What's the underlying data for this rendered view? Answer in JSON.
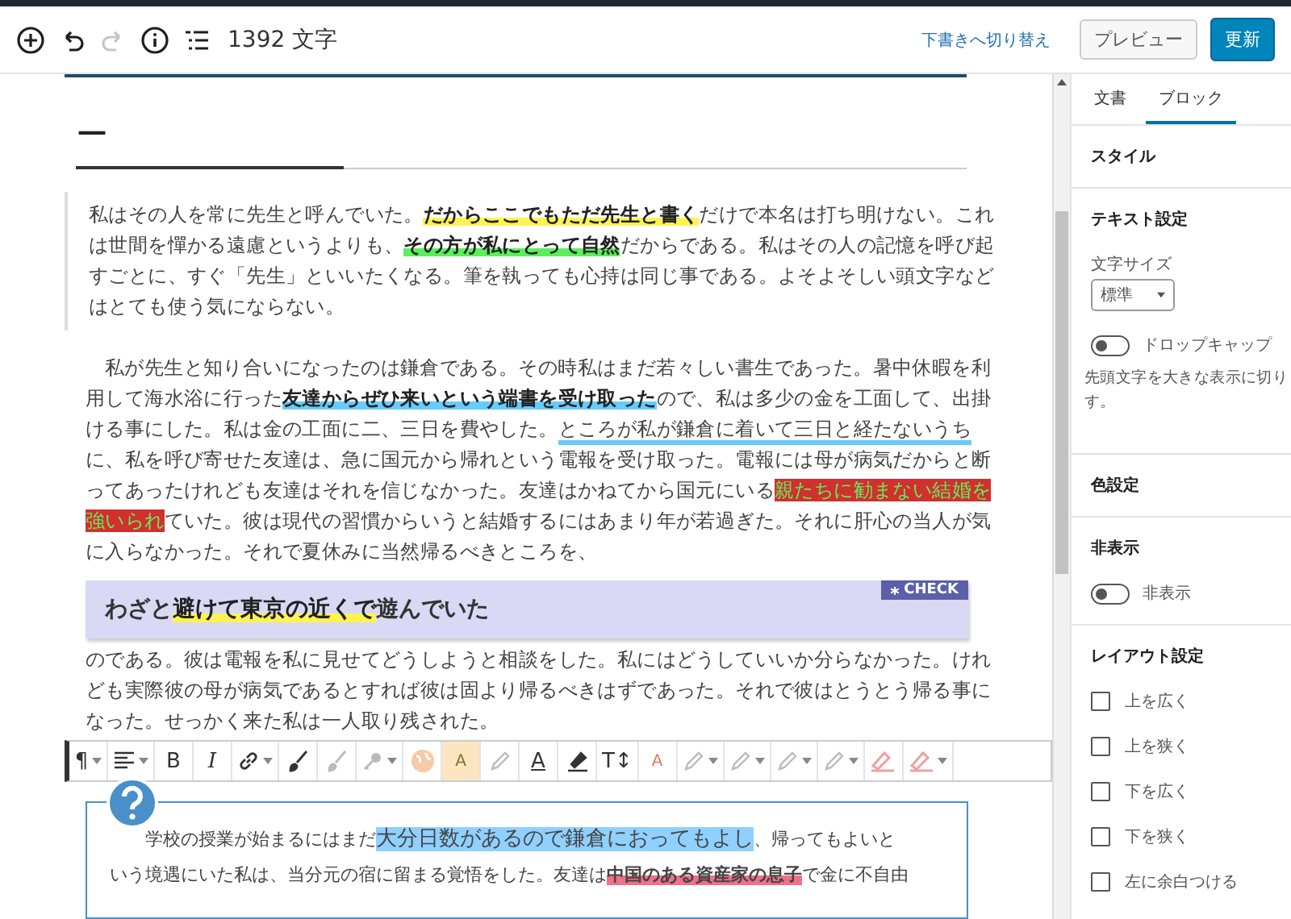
{
  "topbar": {
    "tools": [
      {
        "kind": "add",
        "disabled": false
      },
      {
        "kind": "undo",
        "disabled": false
      },
      {
        "kind": "redo",
        "disabled": true
      },
      {
        "kind": "info",
        "disabled": false
      },
      {
        "kind": "outline",
        "disabled": false
      }
    ],
    "word_count": "1392 文字",
    "draft_link": "下書きへ切り替え",
    "preview_button": "プレビュー",
    "update_button": "更新"
  },
  "editor": {
    "heading": "ー",
    "quote": [
      {
        "text": "私はその人を常に先生と呼んでいた。",
        "kind": "plain"
      },
      {
        "text": "だからここでもただ先生と書く",
        "kind": "yellow"
      },
      {
        "text": "だけで本名は打ち明けない。これは世間を憚かる遠慮というよりも、",
        "kind": "plain"
      },
      {
        "text": "その方が私にとって自然",
        "kind": "green"
      },
      {
        "text": "だからである。私はその人の記憶を呼び起すごとに、すぐ「先生」といいたくなる。筆を執っても心持は同じ事である。よそよそしい頭文字などはとても使う気にならない。",
        "kind": "plain"
      }
    ],
    "paragraph": [
      {
        "text": "私が先生と知り合いになったのは鎌倉である。その時私はまだ若々しい書生であった。暑中休暇を利用して海水浴に行った",
        "kind": "plain"
      },
      {
        "text": "友達からぜひ来いという端書を受け取った",
        "kind": "blue"
      },
      {
        "text": "ので、私は多少の金を工面して、出掛ける事にした。私は金の工面に二、三日を費やした。",
        "kind": "plain"
      },
      {
        "text": "ところが私が鎌倉に着いて三日と経たないうち",
        "kind": "underline"
      },
      {
        "text": "に、私を呼び寄せた友達は、急に国元から帰れという電報を受け取った。電報には母が病気だからと断ってあったけれども友達はそれを信じなかった。友達はかねてから国元にいる",
        "kind": "plain"
      },
      {
        "text": "親たちに勧まない結婚を強いられ",
        "kind": "red"
      },
      {
        "text": "ていた。彼は現代の習慣からいうと結婚するにはあまり年が若過ぎた。それに肝心の当人が気に入らなかった。それで夏休みに当然帰るべきところを、",
        "kind": "plain"
      }
    ],
    "check_box": {
      "badge": "CHECK",
      "text": [
        {
          "text": "わざと",
          "kind": "plain"
        },
        {
          "text": "避けて東京の近くで",
          "kind": "yellow"
        },
        {
          "text": "遊んでいた",
          "kind": "plain"
        }
      ]
    },
    "paragraph_2": "のである。彼は電報を私に見せてどうしようと相談をした。私にはどうしていいか分らなかった。けれども実際彼の母が病気であるとすれば彼は固より帰るべきはずであった。それで彼はとうとう帰る事になった。せっかく来た私は一人取り残された。",
    "toolbar": [
      {
        "label": "¶",
        "kind": "text",
        "disabled": false,
        "caret": true
      },
      {
        "kind": "align",
        "disabled": false,
        "caret": true
      },
      {
        "label": "B",
        "kind": "text",
        "disabled": false,
        "caret": false
      },
      {
        "label": "I",
        "kind": "italic",
        "disabled": false,
        "caret": false
      },
      {
        "kind": "link",
        "disabled": false,
        "caret": true
      },
      {
        "kind": "brush",
        "disabled": false,
        "caret": false
      },
      {
        "kind": "brush",
        "disabled": true,
        "caret": false
      },
      {
        "kind": "key",
        "disabled": true,
        "caret": true
      },
      {
        "kind": "globe",
        "disabled": true,
        "caret": false
      },
      {
        "label": "A",
        "kind": "boxed",
        "disabled": true,
        "caret": false
      },
      {
        "kind": "pencil",
        "disabled": true,
        "caret": false
      },
      {
        "label": "A",
        "kind": "underline",
        "disabled": false,
        "caret": false
      },
      {
        "kind": "marker",
        "disabled": false,
        "caret": false
      },
      {
        "label": "T↕",
        "kind": "text",
        "disabled": false,
        "caret": false
      },
      {
        "label": "A",
        "kind": "faded",
        "disabled": true,
        "caret": false
      },
      {
        "kind": "pencil",
        "disabled": true,
        "caret": true
      },
      {
        "kind": "pencil",
        "disabled": true,
        "caret": true
      },
      {
        "kind": "pencil",
        "disabled": true,
        "caret": true
      },
      {
        "kind": "pencil",
        "disabled": true,
        "caret": true
      },
      {
        "kind": "eraser",
        "disabled": true,
        "caret": false
      },
      {
        "kind": "eraser",
        "disabled": true,
        "caret": true
      }
    ],
    "question_box": {
      "text": [
        {
          "text": "学校の授業が始まるにはまだ",
          "kind": "plain"
        },
        {
          "text": "大分日数があるので鎌倉におってもよし",
          "kind": "big"
        },
        {
          "text": "、帰ってもよいと",
          "kind": "plain"
        },
        {
          "kind": "break"
        },
        {
          "text": "いう境遇にいた私は、当分元の宿に留まる覚悟をした。友達は",
          "kind": "plain"
        },
        {
          "text": "中国のある資産家の息子",
          "kind": "pink"
        },
        {
          "text": "で金に不自由",
          "kind": "plain"
        }
      ]
    }
  },
  "sidebar": {
    "tabs": [
      {
        "label": "文書",
        "selected": false
      },
      {
        "label": "ブロック",
        "selected": true
      }
    ],
    "style_heading": "スタイル",
    "text_heading": "テキスト設定",
    "font_size_label": "文字サイズ",
    "font_size_value": "標準",
    "drop_cap": {
      "label": "ドロップキャップ",
      "on": false,
      "help": [
        "先頭文字を大きな表示に切り",
        "す。"
      ]
    },
    "color_heading": "色設定",
    "hide_heading": "非表示",
    "hide_toggle": {
      "label": "非表示",
      "on": false
    },
    "layout_heading": "レイアウト設定",
    "layout_options": [
      {
        "label": "上を広く",
        "checked": false
      },
      {
        "label": "上を狭く",
        "checked": false
      },
      {
        "label": "下を広く",
        "checked": false
      },
      {
        "label": "下を狭く",
        "checked": false
      },
      {
        "label": "左に余白つける",
        "checked": false
      }
    ]
  }
}
